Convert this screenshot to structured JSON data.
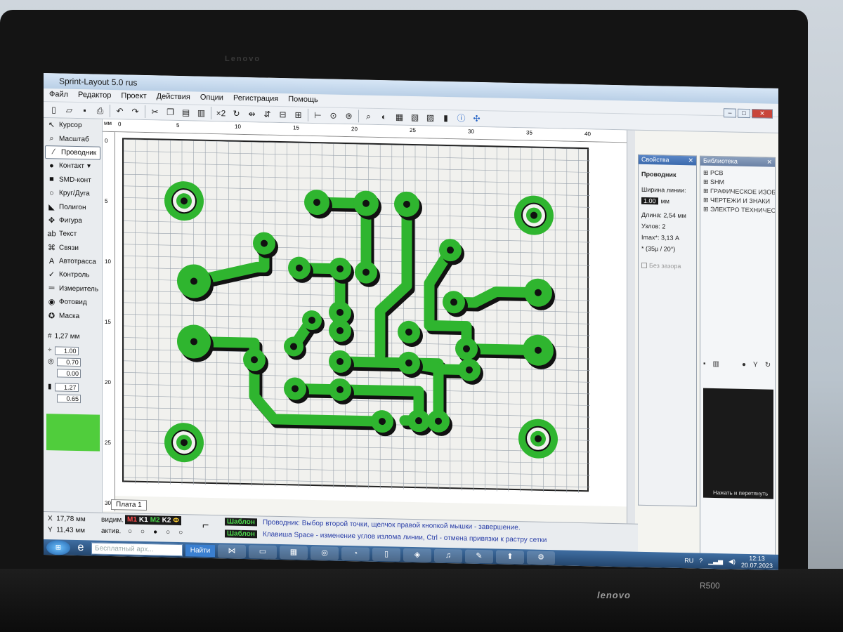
{
  "app": {
    "title": "Sprint-Layout 5.0 rus"
  },
  "menu": [
    "Файл",
    "Редактор",
    "Проект",
    "Действия",
    "Опции",
    "Регистрация",
    "Помощь"
  ],
  "toolbar": {
    "zoom_label": "×2"
  },
  "tools": [
    {
      "label": "Курсор",
      "icon": "cursor-icon",
      "glyph": "↖"
    },
    {
      "label": "Масштаб",
      "icon": "zoom-icon",
      "glyph": "⌕"
    },
    {
      "label": "Проводник",
      "icon": "track-icon",
      "glyph": "∕"
    },
    {
      "label": "Контакт",
      "icon": "pad-icon",
      "glyph": "●"
    },
    {
      "label": "SMD-конт",
      "icon": "smd-icon",
      "glyph": "■"
    },
    {
      "label": "Круг/Дуга",
      "icon": "circle-icon",
      "glyph": "○"
    },
    {
      "label": "Полигон",
      "icon": "polygon-icon",
      "glyph": "◣"
    },
    {
      "label": "Фигура",
      "icon": "shape-icon",
      "glyph": "✥"
    },
    {
      "label": "Текст",
      "icon": "text-icon",
      "glyph": "ab"
    },
    {
      "label": "Связи",
      "icon": "links-icon",
      "glyph": "⌘"
    },
    {
      "label": "Автотрасса",
      "icon": "autoroute-icon",
      "glyph": "A"
    },
    {
      "label": "Контроль",
      "icon": "check-icon",
      "glyph": "✓"
    },
    {
      "label": "Измеритель",
      "icon": "measure-icon",
      "glyph": "═"
    },
    {
      "label": "Фотовид",
      "icon": "photoview-icon",
      "glyph": "◉"
    },
    {
      "label": "Маска",
      "icon": "mask-icon",
      "glyph": "✪"
    }
  ],
  "grid": {
    "value": "1,27 мм"
  },
  "params": [
    "1.00",
    "0.70",
    "0.00",
    "1.27",
    "0.65"
  ],
  "ruler": {
    "unit": "мм",
    "top_ticks": [
      "0",
      "5",
      "10",
      "15",
      "20",
      "25",
      "30",
      "35",
      "40"
    ],
    "left_ticks": [
      "0",
      "5",
      "10",
      "15",
      "20",
      "25",
      "30"
    ]
  },
  "properties": {
    "header": "Свойства",
    "title": "Проводник",
    "width_label": "Ширина линии:",
    "width_value": "1.00",
    "width_unit": "мм",
    "length_label": "Длина:",
    "length_value": "2,54 мм",
    "nodes_label": "Узлов:",
    "nodes_value": "2",
    "imax_label": "Imax*:",
    "imax_value": "3,13 А",
    "note": "* (35µ / 20°)",
    "no_clearance": "Без зазора"
  },
  "library": {
    "header": "Библиотека",
    "items": [
      "PCB",
      "SHM",
      "ГРАФИЧЕСКОЕ ИЗОБР",
      "ЧЕРТЕЖИ И ЗНАКИ",
      "ЭЛЕКТРО ТЕХНИЧЕСК"
    ],
    "preview_hint": "Нажать и перетянуть"
  },
  "status": {
    "x_label": "X",
    "x_value": "17,78 мм",
    "y_label": "Y",
    "y_value": "11,43 мм",
    "visible_label": "видим.",
    "active_label": "актив.",
    "layers": [
      "M1",
      "K1",
      "M2",
      "K2",
      "Ф"
    ],
    "board_tab": "Плата 1",
    "template1": "Шаблон",
    "template2": "Шаблон",
    "message1": "Проводник: Выбор второй точки, щелчок правой кнопкой мышки - завершение.",
    "message2": "Клавиша Space - изменение углов излома линии, Ctrl - отмена привязки к растру сетки"
  },
  "taskbar": {
    "search_placeholder": "Бесплатный арх...",
    "search_button": "Найти",
    "lang": "RU",
    "time": "12:13",
    "date": "20.07.2023"
  },
  "hardware": {
    "brand": "lenovo",
    "model": "R500",
    "monitor_brand": "Lenovo"
  },
  "colors": {
    "track": "#2fb52f",
    "shadow": "#111111",
    "grid": "#9aa3ad",
    "swatch": "#50cd3c"
  }
}
